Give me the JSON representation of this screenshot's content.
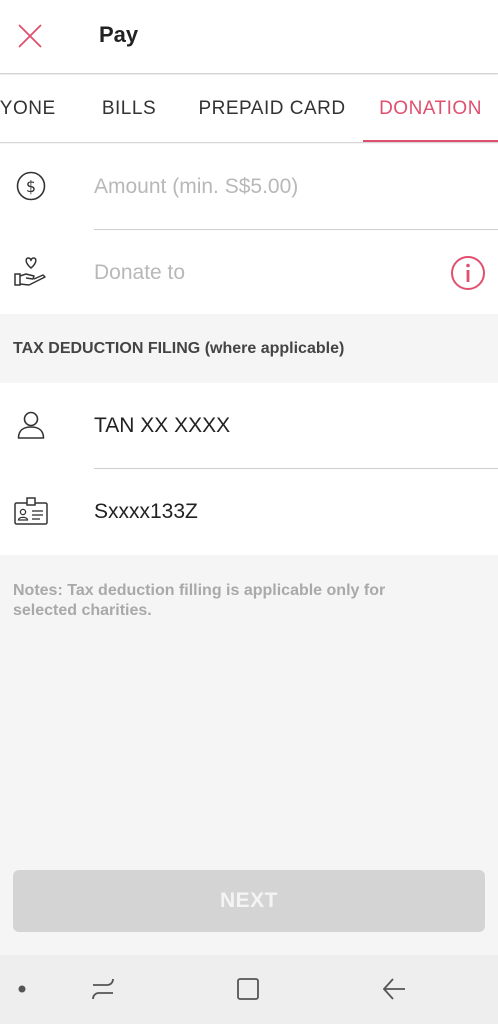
{
  "header": {
    "title": "Pay",
    "close_icon": "close-icon"
  },
  "tabs": [
    {
      "label": "IYONE"
    },
    {
      "label": "BILLS"
    },
    {
      "label": "PREPAID CARD"
    },
    {
      "label": "DONATION",
      "active": true
    }
  ],
  "form": {
    "amount_placeholder": "Amount (min. S$5.00)",
    "donate_placeholder": "Donate to"
  },
  "tax": {
    "section_label": "TAX DEDUCTION FILING (where applicable)",
    "name_value": "TAN XX XXXX",
    "id_value": "Sxxxx133Z"
  },
  "notes": "Notes: Tax deduction filling is applicable only for selected charities.",
  "next_label": "NEXT",
  "colors": {
    "accent": "#e0506e",
    "disabled_button": "#d4d4d4",
    "background": "#f5f5f5"
  }
}
